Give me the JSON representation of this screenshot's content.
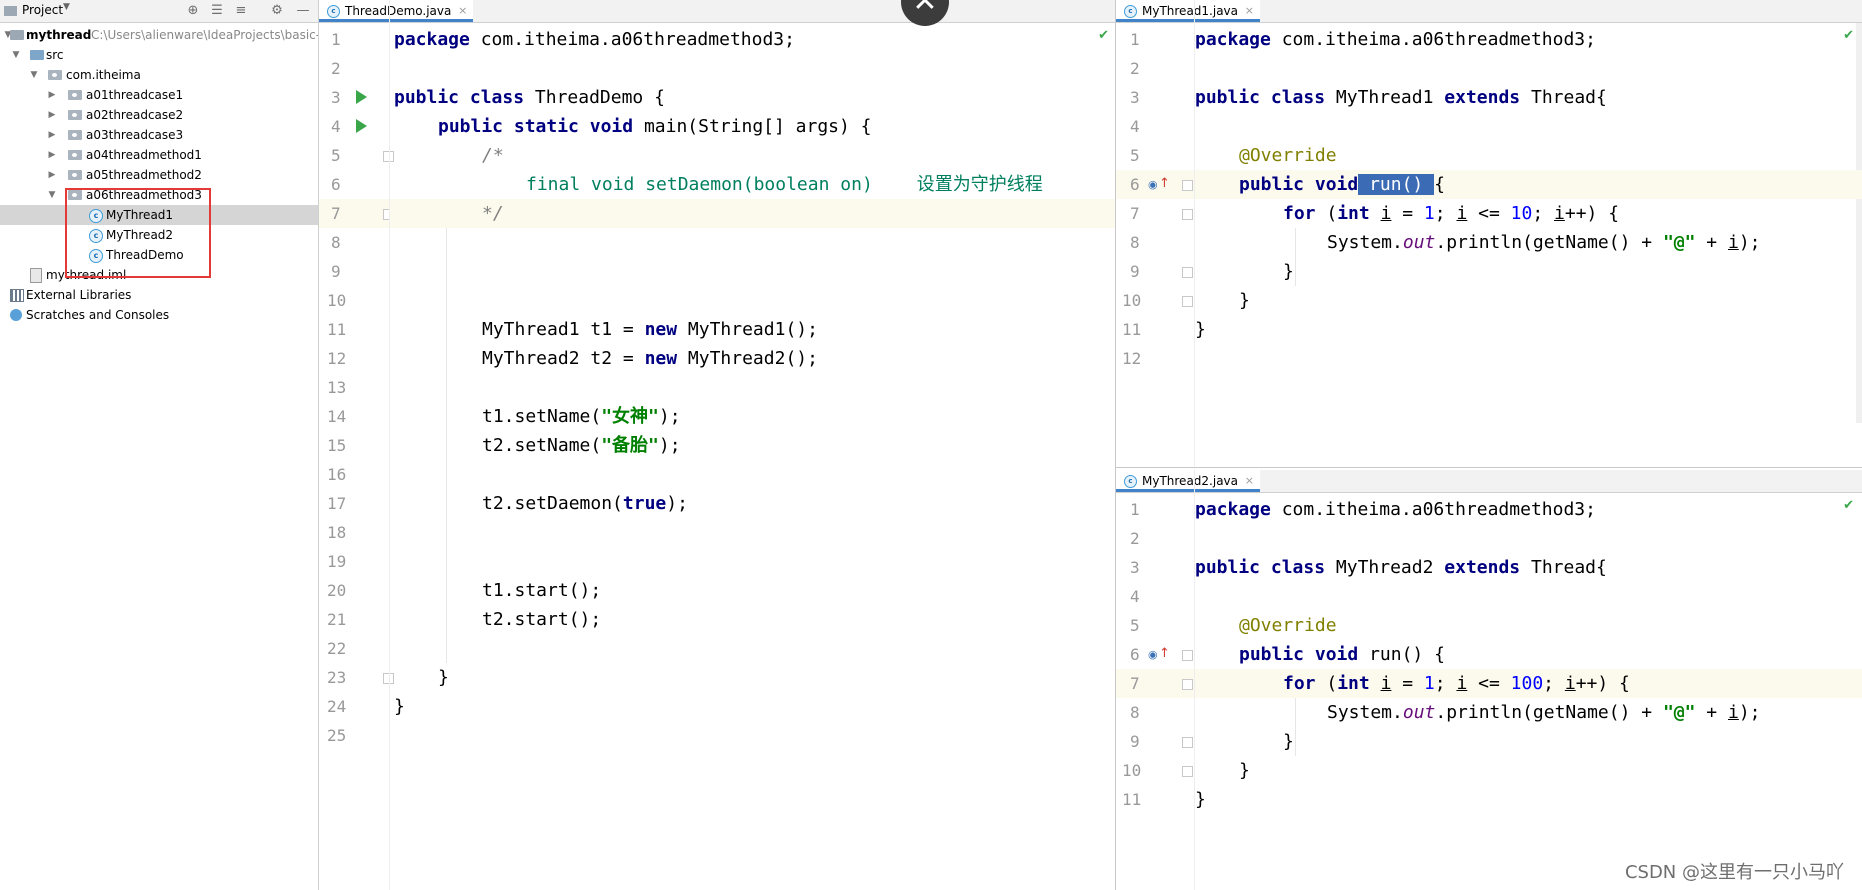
{
  "project": {
    "toolbar_label": "Project",
    "root_name": "mythread",
    "root_path": "C:\\Users\\alienware\\IdeaProjects\\basic-",
    "items": [
      {
        "label": "src"
      },
      {
        "label": "com.itheima"
      },
      {
        "label": "a01threadcase1"
      },
      {
        "label": "a02threadcase2"
      },
      {
        "label": "a03threadcase3"
      },
      {
        "label": "a04threadmethod1"
      },
      {
        "label": "a05threadmethod2"
      },
      {
        "label": "a06threadmethod3"
      },
      {
        "label": "MyThread1"
      },
      {
        "label": "MyThread2"
      },
      {
        "label": "ThreadDemo"
      },
      {
        "label": "mythread.iml"
      },
      {
        "label": "External Libraries"
      },
      {
        "label": "Scratches and Consoles"
      }
    ]
  },
  "editor_main": {
    "tab": "ThreadDemo.java",
    "lines": [
      "1",
      "2",
      "3",
      "4",
      "5",
      "6",
      "7",
      "8",
      "9",
      "10",
      "11",
      "12",
      "13",
      "14",
      "15",
      "16",
      "17",
      "18",
      "19",
      "20",
      "21",
      "22",
      "23",
      "24",
      "25"
    ],
    "code": {
      "l1_kw": "package",
      "l1_rest": " com.itheima.a06threadmethod3;",
      "l3_kw1": "public",
      "l3_kw2": "class",
      "l3_rest": " ThreadDemo {",
      "l4_kw1": "public",
      "l4_kw2": "static",
      "l4_kw3": "void",
      "l4_rest": " main(String[] args) {",
      "l5": "/*",
      "l6_code": "final void setDaemon(boolean on)",
      "l6_comment": "设置为守护线程",
      "l7": "*/",
      "l11_a": "MyThread1 t1 = ",
      "l11_kw": "new",
      "l11_b": " MyThread1();",
      "l12_a": "MyThread2 t2 = ",
      "l12_kw": "new",
      "l12_b": " MyThread2();",
      "l14_a": "t1.setName(",
      "l14_str": "\"女神\"",
      "l14_b": ");",
      "l15_a": "t2.setName(",
      "l15_str": "\"备胎\"",
      "l15_b": ");",
      "l17_a": "t2.setDaemon(",
      "l17_kw": "true",
      "l17_b": ");",
      "l20": "t1.start();",
      "l21": "t2.start();",
      "l23": "}",
      "l24": "}"
    }
  },
  "editor_top": {
    "tab": "MyThread1.java",
    "lines": [
      "1",
      "2",
      "3",
      "4",
      "5",
      "6",
      "7",
      "8",
      "9",
      "10",
      "11",
      "12"
    ],
    "code": {
      "l1_kw": "package",
      "l1_rest": " com.itheima.a06threadmethod3;",
      "l3_kw1": "public",
      "l3_kw2": "class",
      "l3_mid": " MyThread1 ",
      "l3_kw3": "extends",
      "l3_rest": " Thread{",
      "l5": "@Override",
      "l6_kw1": "public",
      "l6_kw2": "void",
      "l6_sel": " run() ",
      "l6_rest": "{",
      "l7_kw": "for",
      "l7_a": " (",
      "l7_kw2": "int",
      "l7_b": " ",
      "l7_i1": "i",
      "l7_c": " = ",
      "l7_n1": "1",
      "l7_d": "; ",
      "l7_i2": "i",
      "l7_e": " <= ",
      "l7_n2": "10",
      "l7_f": "; ",
      "l7_i3": "i",
      "l7_g": "++) {",
      "l8_a": "System.",
      "l8_fld": "out",
      "l8_b": ".println(getName() + ",
      "l8_str": "\"@\"",
      "l8_c": " + ",
      "l8_i": "i",
      "l8_d": ");",
      "l9": "}",
      "l10": "}",
      "l11": "}"
    }
  },
  "editor_bottom": {
    "tab": "MyThread2.java",
    "lines": [
      "1",
      "2",
      "3",
      "4",
      "5",
      "6",
      "7",
      "8",
      "9",
      "10",
      "11"
    ],
    "code": {
      "l1_kw": "package",
      "l1_rest": " com.itheima.a06threadmethod3;",
      "l3_kw1": "public",
      "l3_kw2": "class",
      "l3_mid": " MyThread2 ",
      "l3_kw3": "extends",
      "l3_rest": " Thread{",
      "l5": "@Override",
      "l6_kw1": "public",
      "l6_kw2": "void",
      "l6_rest": " run() {",
      "l7_kw": "for",
      "l7_a": " (",
      "l7_kw2": "int",
      "l7_b": " ",
      "l7_i1": "i",
      "l7_c": " = ",
      "l7_n1": "1",
      "l7_d": "; ",
      "l7_i2": "i",
      "l7_e": " <= ",
      "l7_n2": "100",
      "l7_f": "; ",
      "l7_i3": "i",
      "l7_g": "++) {",
      "l8_a": "System.",
      "l8_fld": "out",
      "l8_b": ".println(getName() + ",
      "l8_str": "\"@\"",
      "l8_c": " + ",
      "l8_i": "i",
      "l8_d": ");",
      "l9": "}",
      "l10": "}",
      "l11": "}"
    }
  },
  "overlay": {
    "close_symbol": "✕"
  },
  "watermark": "CSDN @这里有一只小马吖"
}
